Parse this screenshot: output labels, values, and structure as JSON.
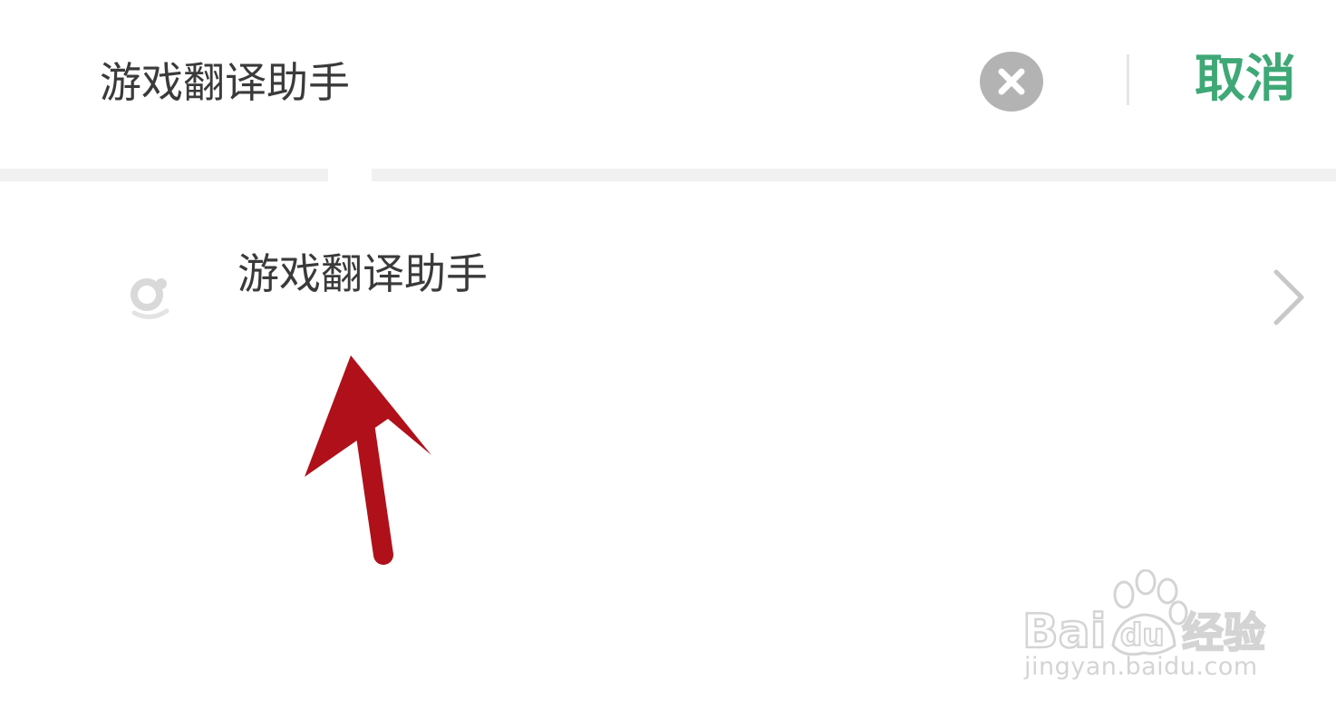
{
  "search": {
    "value": "游戏翻译助手",
    "cancel_label": "取消"
  },
  "results": [
    {
      "label": "游戏翻译助手"
    }
  ],
  "watermark": {
    "url": "jingyan.baidu.com"
  },
  "colors": {
    "accent": "#3ea876",
    "text": "#3a3a3a",
    "arrow": "#b0101a"
  },
  "icons": {
    "clear": "clear-circle-icon",
    "result": "mini-program-icon",
    "chevron": "chevron-right-icon",
    "annotation": "red-arrow-icon"
  }
}
